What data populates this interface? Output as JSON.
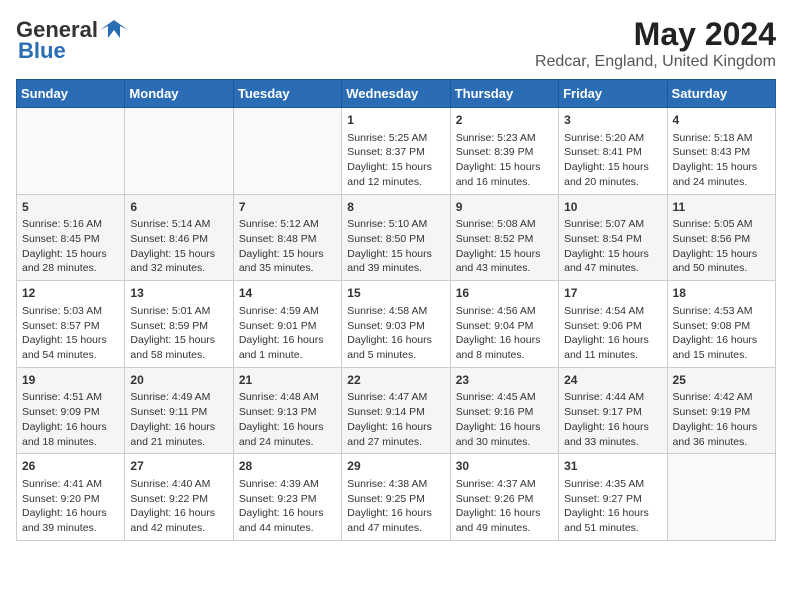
{
  "header": {
    "logo_general": "General",
    "logo_blue": "Blue",
    "title": "May 2024",
    "subtitle": "Redcar, England, United Kingdom"
  },
  "days_of_week": [
    "Sunday",
    "Monday",
    "Tuesday",
    "Wednesday",
    "Thursday",
    "Friday",
    "Saturday"
  ],
  "weeks": [
    [
      {
        "day": "",
        "info": ""
      },
      {
        "day": "",
        "info": ""
      },
      {
        "day": "",
        "info": ""
      },
      {
        "day": "1",
        "info": "Sunrise: 5:25 AM\nSunset: 8:37 PM\nDaylight: 15 hours\nand 12 minutes."
      },
      {
        "day": "2",
        "info": "Sunrise: 5:23 AM\nSunset: 8:39 PM\nDaylight: 15 hours\nand 16 minutes."
      },
      {
        "day": "3",
        "info": "Sunrise: 5:20 AM\nSunset: 8:41 PM\nDaylight: 15 hours\nand 20 minutes."
      },
      {
        "day": "4",
        "info": "Sunrise: 5:18 AM\nSunset: 8:43 PM\nDaylight: 15 hours\nand 24 minutes."
      }
    ],
    [
      {
        "day": "5",
        "info": "Sunrise: 5:16 AM\nSunset: 8:45 PM\nDaylight: 15 hours\nand 28 minutes."
      },
      {
        "day": "6",
        "info": "Sunrise: 5:14 AM\nSunset: 8:46 PM\nDaylight: 15 hours\nand 32 minutes."
      },
      {
        "day": "7",
        "info": "Sunrise: 5:12 AM\nSunset: 8:48 PM\nDaylight: 15 hours\nand 35 minutes."
      },
      {
        "day": "8",
        "info": "Sunrise: 5:10 AM\nSunset: 8:50 PM\nDaylight: 15 hours\nand 39 minutes."
      },
      {
        "day": "9",
        "info": "Sunrise: 5:08 AM\nSunset: 8:52 PM\nDaylight: 15 hours\nand 43 minutes."
      },
      {
        "day": "10",
        "info": "Sunrise: 5:07 AM\nSunset: 8:54 PM\nDaylight: 15 hours\nand 47 minutes."
      },
      {
        "day": "11",
        "info": "Sunrise: 5:05 AM\nSunset: 8:56 PM\nDaylight: 15 hours\nand 50 minutes."
      }
    ],
    [
      {
        "day": "12",
        "info": "Sunrise: 5:03 AM\nSunset: 8:57 PM\nDaylight: 15 hours\nand 54 minutes."
      },
      {
        "day": "13",
        "info": "Sunrise: 5:01 AM\nSunset: 8:59 PM\nDaylight: 15 hours\nand 58 minutes."
      },
      {
        "day": "14",
        "info": "Sunrise: 4:59 AM\nSunset: 9:01 PM\nDaylight: 16 hours\nand 1 minute."
      },
      {
        "day": "15",
        "info": "Sunrise: 4:58 AM\nSunset: 9:03 PM\nDaylight: 16 hours\nand 5 minutes."
      },
      {
        "day": "16",
        "info": "Sunrise: 4:56 AM\nSunset: 9:04 PM\nDaylight: 16 hours\nand 8 minutes."
      },
      {
        "day": "17",
        "info": "Sunrise: 4:54 AM\nSunset: 9:06 PM\nDaylight: 16 hours\nand 11 minutes."
      },
      {
        "day": "18",
        "info": "Sunrise: 4:53 AM\nSunset: 9:08 PM\nDaylight: 16 hours\nand 15 minutes."
      }
    ],
    [
      {
        "day": "19",
        "info": "Sunrise: 4:51 AM\nSunset: 9:09 PM\nDaylight: 16 hours\nand 18 minutes."
      },
      {
        "day": "20",
        "info": "Sunrise: 4:49 AM\nSunset: 9:11 PM\nDaylight: 16 hours\nand 21 minutes."
      },
      {
        "day": "21",
        "info": "Sunrise: 4:48 AM\nSunset: 9:13 PM\nDaylight: 16 hours\nand 24 minutes."
      },
      {
        "day": "22",
        "info": "Sunrise: 4:47 AM\nSunset: 9:14 PM\nDaylight: 16 hours\nand 27 minutes."
      },
      {
        "day": "23",
        "info": "Sunrise: 4:45 AM\nSunset: 9:16 PM\nDaylight: 16 hours\nand 30 minutes."
      },
      {
        "day": "24",
        "info": "Sunrise: 4:44 AM\nSunset: 9:17 PM\nDaylight: 16 hours\nand 33 minutes."
      },
      {
        "day": "25",
        "info": "Sunrise: 4:42 AM\nSunset: 9:19 PM\nDaylight: 16 hours\nand 36 minutes."
      }
    ],
    [
      {
        "day": "26",
        "info": "Sunrise: 4:41 AM\nSunset: 9:20 PM\nDaylight: 16 hours\nand 39 minutes."
      },
      {
        "day": "27",
        "info": "Sunrise: 4:40 AM\nSunset: 9:22 PM\nDaylight: 16 hours\nand 42 minutes."
      },
      {
        "day": "28",
        "info": "Sunrise: 4:39 AM\nSunset: 9:23 PM\nDaylight: 16 hours\nand 44 minutes."
      },
      {
        "day": "29",
        "info": "Sunrise: 4:38 AM\nSunset: 9:25 PM\nDaylight: 16 hours\nand 47 minutes."
      },
      {
        "day": "30",
        "info": "Sunrise: 4:37 AM\nSunset: 9:26 PM\nDaylight: 16 hours\nand 49 minutes."
      },
      {
        "day": "31",
        "info": "Sunrise: 4:35 AM\nSunset: 9:27 PM\nDaylight: 16 hours\nand 51 minutes."
      },
      {
        "day": "",
        "info": ""
      }
    ]
  ]
}
